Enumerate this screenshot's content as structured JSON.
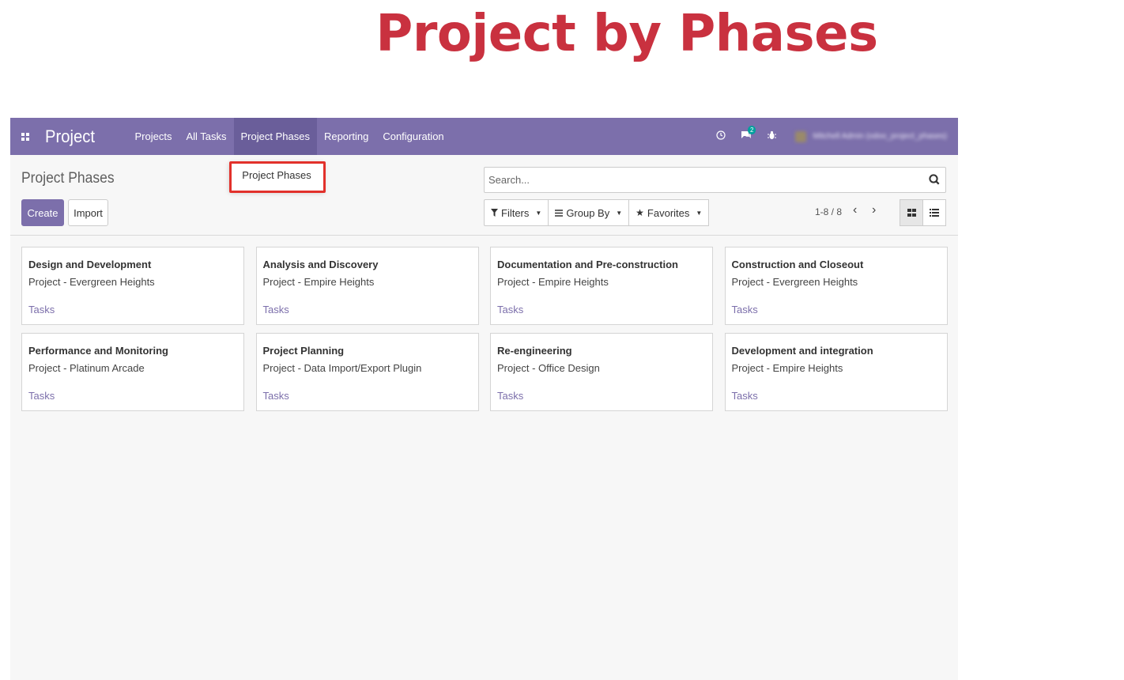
{
  "hero": {
    "title": "Project by Phases"
  },
  "navbar": {
    "brand": "Project",
    "menu": [
      "Projects",
      "All Tasks",
      "Project Phases",
      "Reporting",
      "Configuration"
    ],
    "active_index": 2,
    "messages_badge": "2",
    "user": "Mitchell Admin (odoo_project_phases)"
  },
  "dropdown": {
    "item": "Project Phases"
  },
  "control": {
    "breadcrumb": "Project Phases",
    "create_label": "Create",
    "import_label": "Import",
    "search_placeholder": "Search...",
    "filters_label": "Filters",
    "groupby_label": "Group By",
    "favorites_label": "Favorites",
    "pager": "1-8 / 8"
  },
  "cards": [
    {
      "title": "Design and Development",
      "project": "Project - Evergreen Heights",
      "link": "Tasks"
    },
    {
      "title": "Analysis and Discovery",
      "project": "Project - Empire Heights",
      "link": "Tasks"
    },
    {
      "title": "Documentation and Pre-construction",
      "project": "Project - Empire Heights",
      "link": "Tasks"
    },
    {
      "title": "Construction and Closeout",
      "project": "Project - Evergreen Heights",
      "link": "Tasks"
    },
    {
      "title": "Performance and Monitoring",
      "project": "Project - Platinum Arcade",
      "link": "Tasks"
    },
    {
      "title": "Project Planning",
      "project": "Project - Data Import/Export Plugin",
      "link": "Tasks"
    },
    {
      "title": "Re-engineering",
      "project": "Project - Office Design",
      "link": "Tasks"
    },
    {
      "title": "Development and integration",
      "project": "Project - Empire Heights",
      "link": "Tasks"
    }
  ],
  "colors": {
    "brand": "#7c6fab",
    "hero": "#c9313f",
    "highlight": "#e2312b"
  }
}
